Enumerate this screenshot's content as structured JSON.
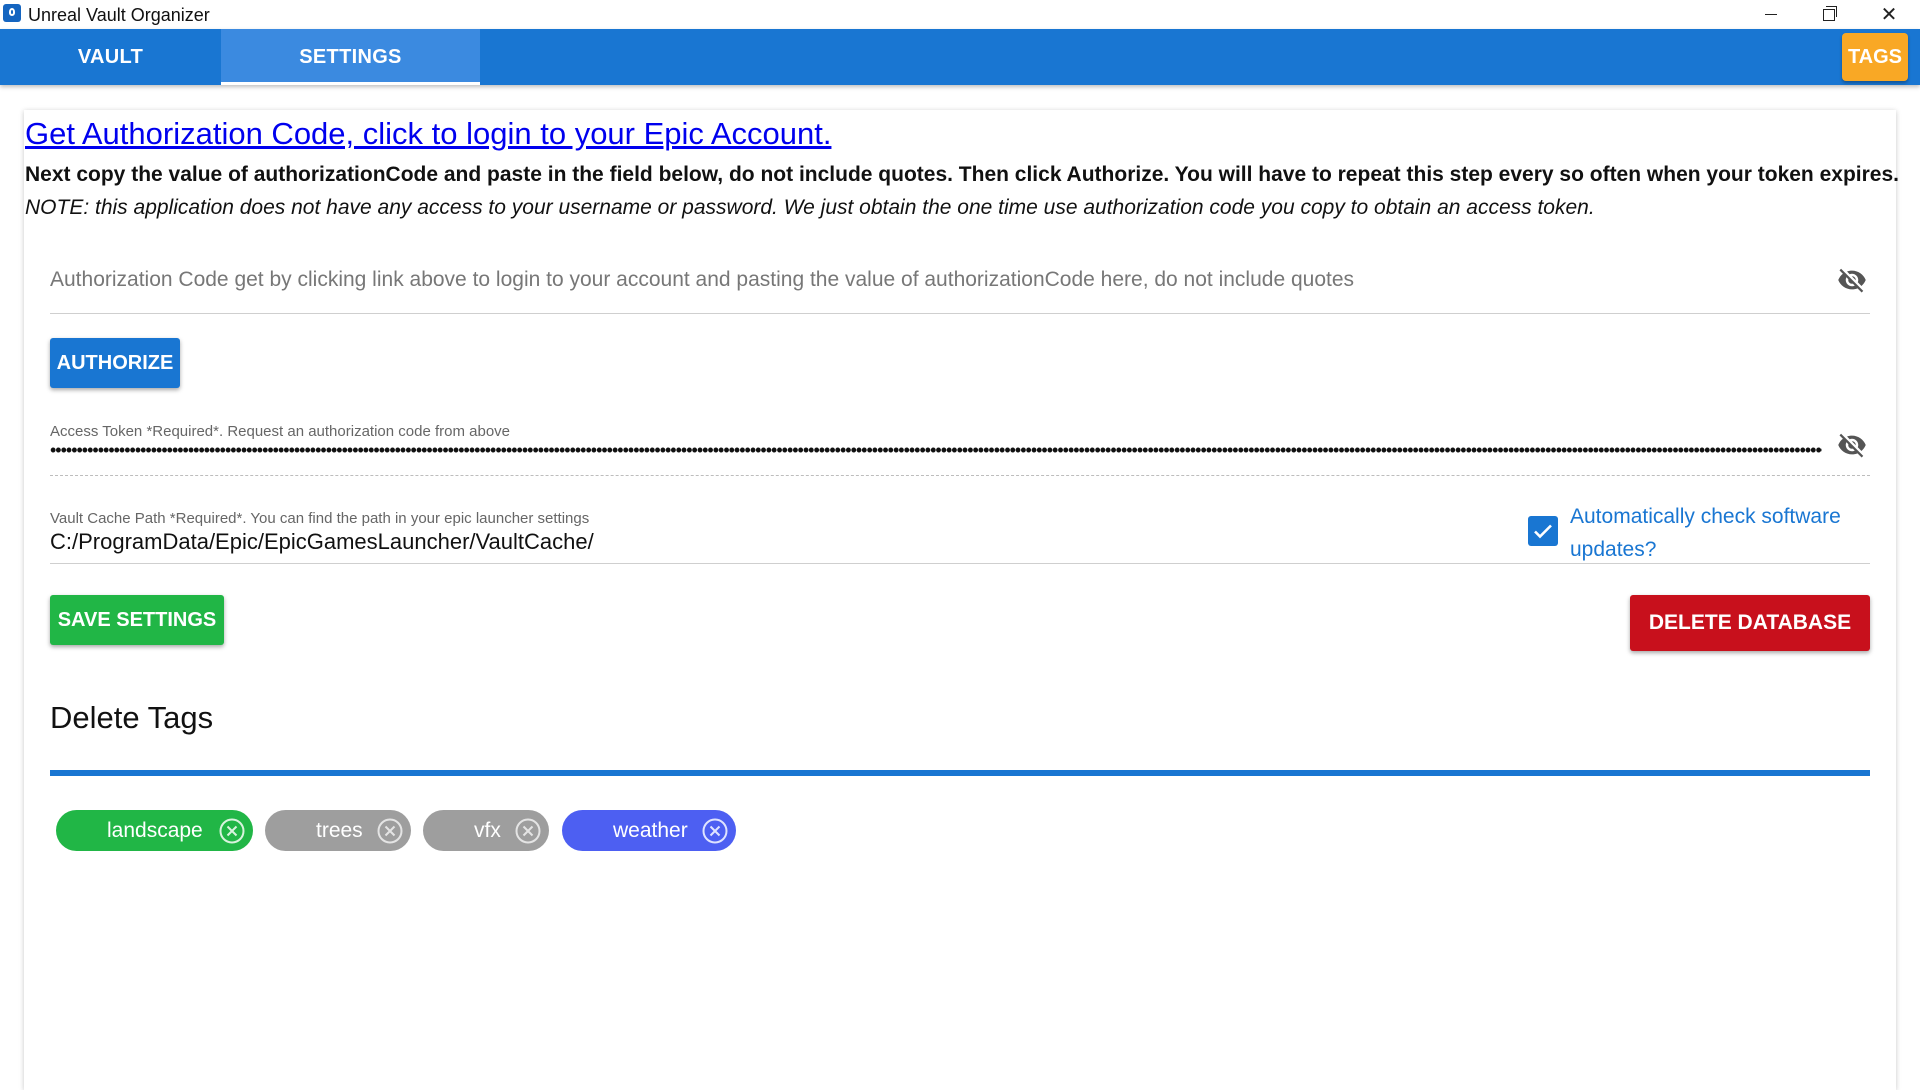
{
  "window": {
    "title": "Unreal Vault Organizer",
    "controls": {
      "minimize": "minimize",
      "maximize": "restore",
      "close": "close"
    }
  },
  "appbar": {
    "tabs": [
      {
        "label": "VAULT",
        "active": false
      },
      {
        "label": "SETTINGS",
        "active": true
      }
    ],
    "tags_button": "TAGS",
    "colors": {
      "bar": "#1976d2",
      "tags": "#f9a825"
    }
  },
  "settings": {
    "auth_link": "Get Authorization Code, click to login to your Epic Account.",
    "instructions": "Next copy the value of authorizationCode and paste in the field below, do not include quotes. Then click Authorize. You will have to repeat this step every so often when your token expires.",
    "note": "NOTE: this application does not have any access to your username or password. We just obtain the one time use authorization code you copy to obtain an access token.",
    "auth_code": {
      "value": "",
      "placeholder": "Authorization Code get by clicking link above to login to your account and pasting the value of authorizationCode here, do not include quotes",
      "icon": "eye-off-icon"
    },
    "authorize_button": "AUTHORIZE",
    "access_token": {
      "label": "Access Token *Required*. Request an authorization code from above",
      "masked_value": "••••••••••••••••••••••••••••••••••••••••••••••••••••••••••••••••••••••••••••••••••••••••••••••••••••••••••••••••••••••••••••••••••••••••••••••••••••••••••••••••••••••••••••••••••••••••••••••••••••••••••••••••••••••••••••••••••••••••••••••••••••••••••••••••••••••••••••••••••••••••••••••••••••••••••••••••••••••••••••••••••••••••••••••••",
      "icon": "eye-off-icon"
    },
    "vault_cache_path": {
      "label": "Vault Cache Path *Required*. You can find the path in your epic launcher settings",
      "value": "C:/ProgramData/Epic/EpicGamesLauncher/VaultCache/"
    },
    "auto_update": {
      "checked": true,
      "label": "Automatically check software updates?"
    },
    "save_button": "SAVE SETTINGS",
    "delete_db_button": "DELETE DATABASE",
    "colors": {
      "save": "#21b646",
      "delete": "#c8101c",
      "primary": "#1976d2"
    }
  },
  "delete_tags": {
    "title": "Delete Tags",
    "tags": [
      {
        "label": "landscape",
        "color": "#21b646"
      },
      {
        "label": "trees",
        "color": "#9e9e9e"
      },
      {
        "label": "vfx",
        "color": "#9e9e9e"
      },
      {
        "label": "weather",
        "color": "#4d5ff2"
      }
    ]
  }
}
